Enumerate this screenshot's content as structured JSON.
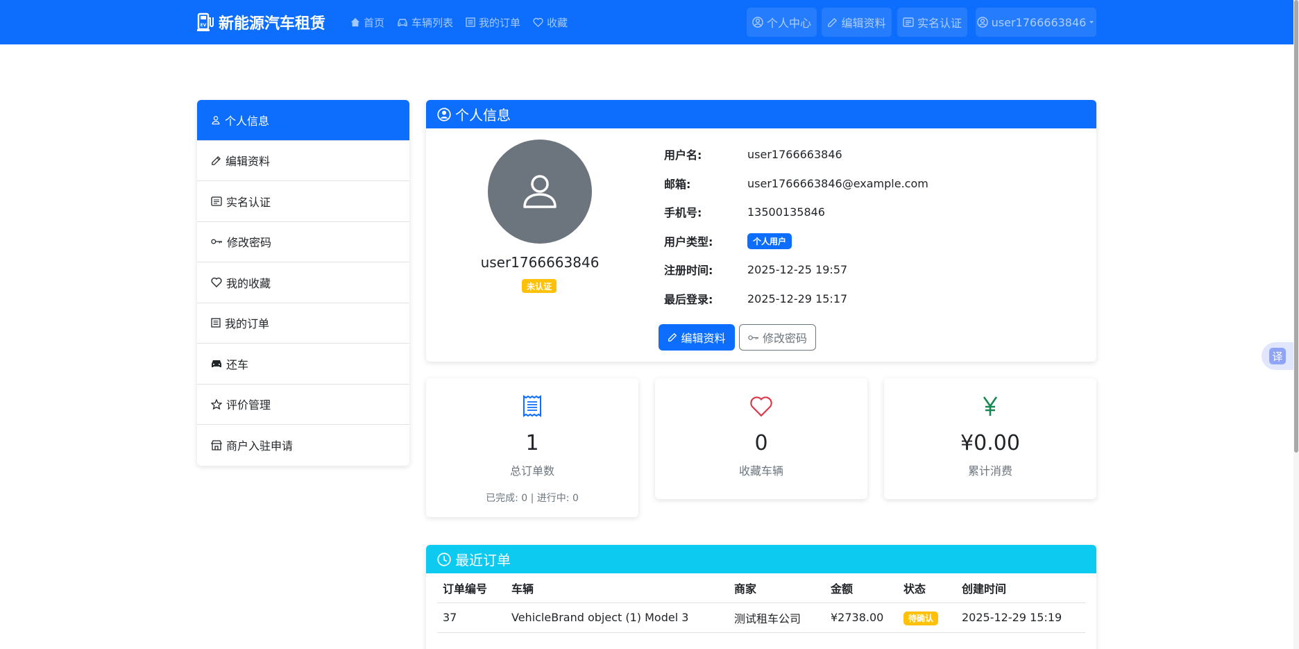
{
  "navbar": {
    "brand": "新能源汽车租赁",
    "links": [
      {
        "label": "首页",
        "icon": "house-icon"
      },
      {
        "label": "车辆列表",
        "icon": "car-icon"
      },
      {
        "label": "我的订单",
        "icon": "list-icon"
      },
      {
        "label": "收藏",
        "icon": "heart-icon"
      }
    ],
    "right": [
      {
        "label": "个人中心",
        "icon": "person-circle-icon"
      },
      {
        "label": "编辑资料",
        "icon": "pencil-icon"
      },
      {
        "label": "实名认证",
        "icon": "card-icon"
      }
    ],
    "user_menu": "user1766663846"
  },
  "sidebar": {
    "items": [
      {
        "label": "个人信息",
        "icon": "person-icon",
        "active": true
      },
      {
        "label": "编辑资料",
        "icon": "pencil-icon"
      },
      {
        "label": "实名认证",
        "icon": "card-icon"
      },
      {
        "label": "修改密码",
        "icon": "key-icon"
      },
      {
        "label": "我的收藏",
        "icon": "heart-icon"
      },
      {
        "label": "我的订单",
        "icon": "list-icon"
      },
      {
        "label": "还车",
        "icon": "car-front-icon"
      },
      {
        "label": "评价管理",
        "icon": "star-icon"
      },
      {
        "label": "商户入驻申请",
        "icon": "shop-icon"
      }
    ]
  },
  "profile": {
    "title": "个人信息",
    "username_display": "user1766663846",
    "verify_badge": "未认证",
    "fields": [
      {
        "label": "用户名:",
        "value": "user1766663846"
      },
      {
        "label": "邮箱:",
        "value": "user1766663846@example.com"
      },
      {
        "label": "手机号:",
        "value": "13500135846"
      },
      {
        "label": "用户类型:",
        "value": "个人用户"
      },
      {
        "label": "注册时间:",
        "value": "2025-12-25 19:57"
      },
      {
        "label": "最后登录:",
        "value": "2025-12-29 15:17"
      }
    ],
    "edit_button": "编辑资料",
    "password_button": "修改密码"
  },
  "stats": [
    {
      "value": "1",
      "label": "总订单数",
      "sub": "已完成: 0 | 进行中: 0",
      "color": "#0d6efd",
      "icon": "receipt-icon"
    },
    {
      "value": "0",
      "label": "收藏车辆",
      "color": "#dc3545",
      "icon": "heart-icon"
    },
    {
      "value": "¥0.00",
      "label": "累计消费",
      "color": "#198754",
      "icon": "yen-icon"
    }
  ],
  "orders": {
    "title": "最近订单",
    "columns": [
      "订单编号",
      "车辆",
      "商家",
      "金额",
      "状态",
      "创建时间"
    ],
    "rows": [
      [
        "37",
        "VehicleBrand object (1) Model 3",
        "测试租车公司",
        "¥2738.00",
        "待确认",
        "2025-12-29 15:19"
      ]
    ]
  },
  "translate_label": "译",
  "colors": {
    "primary": "#0d6efd",
    "info": "#0dcaf0",
    "warning": "#ffc107",
    "secondary": "#6c757d"
  }
}
